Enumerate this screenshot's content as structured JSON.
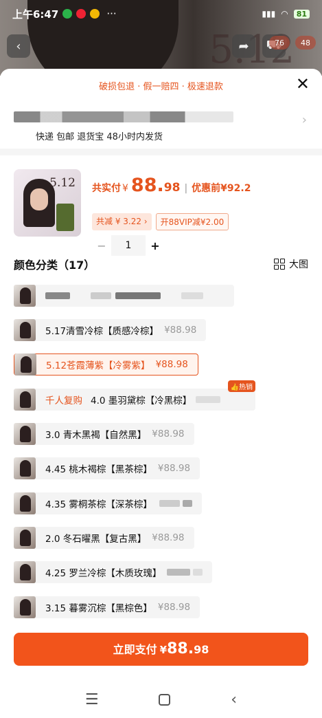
{
  "status": {
    "time": "上午6:47",
    "battery": "81",
    "menu_dots": "···"
  },
  "top": {
    "cart_badge": "76",
    "more_badge": "48"
  },
  "banner": "破损包退 · 假一赔四 · 极速退款",
  "address": {
    "shipping": "快递 包邮 退货宝 48小时内发货"
  },
  "product": {
    "image_label": "5.12",
    "paid_label": "共实付",
    "yen": "¥",
    "price_int": "88.",
    "price_dec": "98",
    "orig_label": "优惠前¥92.2",
    "discount_tag": "共减 ¥ 3.22 ›",
    "vip_tag": "开88VIP减¥2.00",
    "minus": "−",
    "qty": "1",
    "plus": "+"
  },
  "category": {
    "title": "颜色分类（17）",
    "view_label": "大图"
  },
  "options": [
    {
      "name": "",
      "price": ""
    },
    {
      "name": "5.17清雪冷棕【质感冷棕】",
      "price": "¥88.98"
    },
    {
      "name": "5.12苍霞薄紫【冷雾紫】",
      "price": "¥88.98"
    },
    {
      "hot": "千人复购",
      "name": "4.0 墨羽黛棕【冷黑棕】",
      "price": "",
      "badge": "热销"
    },
    {
      "name": "3.0 青木黑褐【自然黑】",
      "price": "¥88.98"
    },
    {
      "name": "4.45 桃木褐棕【黑茶棕】",
      "price": "¥88.98"
    },
    {
      "name": "4.35 雾桐茶棕【深茶棕】",
      "price": ""
    },
    {
      "name": "2.0 冬石曜黑【复古黑】",
      "price": "¥88.98"
    },
    {
      "name": "4.25 罗兰冷棕【木质玫瑰】",
      "price": ""
    },
    {
      "name": "3.15 暮雾沉棕【黑棕色】",
      "price": "¥88.98"
    }
  ],
  "pay": {
    "label": "立即支付",
    "yen": "¥",
    "int": "88.",
    "dec": "98"
  },
  "colors": {
    "accent": "#e5541e",
    "pay_button": "#f2541b"
  }
}
